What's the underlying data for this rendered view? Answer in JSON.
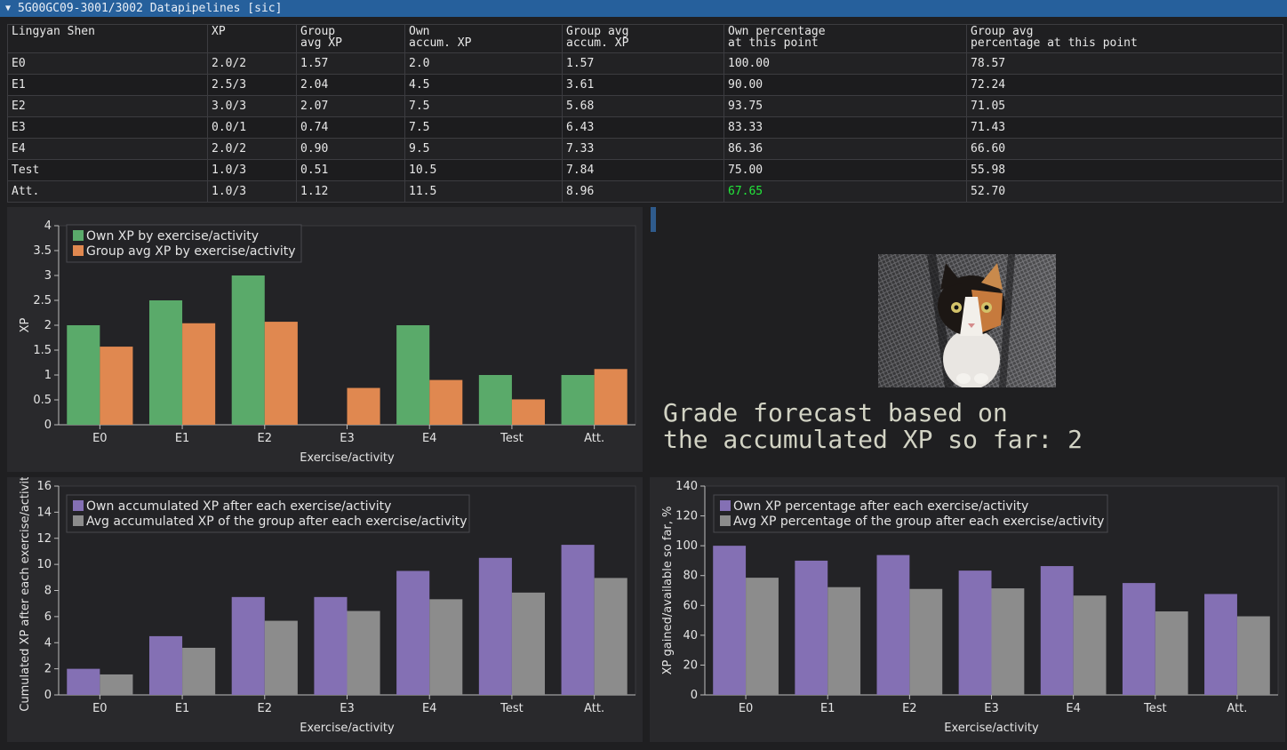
{
  "window": {
    "title": "5G00GC09-3001/3002 Datapipelines [sic]",
    "collapse_arrow": "▼"
  },
  "table": {
    "headers": [
      [
        "Lingyan Shen"
      ],
      [
        "XP"
      ],
      [
        "Group",
        "avg XP"
      ],
      [
        "Own",
        "accum. XP"
      ],
      [
        "Group avg",
        "accum. XP"
      ],
      [
        "Own percentage",
        "at this point"
      ],
      [
        "Group avg",
        "percentage at this point"
      ]
    ],
    "rows": [
      [
        "E0",
        "2.0/2",
        "1.57",
        "2.0",
        "1.57",
        "100.00",
        "78.57"
      ],
      [
        "E1",
        "2.5/3",
        "2.04",
        "4.5",
        "3.61",
        "90.00",
        "72.24"
      ],
      [
        "E2",
        "3.0/3",
        "2.07",
        "7.5",
        "5.68",
        "93.75",
        "71.05"
      ],
      [
        "E3",
        "0.0/1",
        "0.74",
        "7.5",
        "6.43",
        "83.33",
        "71.43"
      ],
      [
        "E4",
        "2.0/2",
        "0.90",
        "9.5",
        "7.33",
        "86.36",
        "66.60"
      ],
      [
        "Test",
        "1.0/3",
        "0.51",
        "10.5",
        "7.84",
        "75.00",
        "55.98"
      ],
      [
        "Att.",
        "1.0/3",
        "1.12",
        "11.5",
        "8.96",
        "67.65",
        "52.70"
      ]
    ],
    "highlight_cell": {
      "row": 6,
      "col": 5,
      "color": "#22e63a"
    }
  },
  "forecast": {
    "text": "Grade forecast based on\nthe accumulated XP so far: 2"
  },
  "image": {
    "subject": "calico-kitten-photo"
  },
  "colors": {
    "own_xp": "#5aaa6a",
    "group_xp": "#e08850",
    "own_accum": "#8470b4",
    "group_accum": "#8c8c8c",
    "background": "#1f1f21",
    "panel": "#29292c",
    "titlebar": "#26609c"
  },
  "chart_data": [
    {
      "type": "bar",
      "categories": [
        "E0",
        "E1",
        "E2",
        "E3",
        "E4",
        "Test",
        "Att."
      ],
      "series": [
        {
          "name": "Own XP by exercise/activity",
          "values": [
            2.0,
            2.5,
            3.0,
            0.0,
            2.0,
            1.0,
            1.0
          ]
        },
        {
          "name": "Group avg XP by exercise/activity",
          "values": [
            1.57,
            2.04,
            2.07,
            0.74,
            0.9,
            0.51,
            1.12
          ]
        }
      ],
      "xlabel": "Exercise/activity",
      "ylabel": "XP",
      "ylim": [
        0,
        4
      ],
      "yticks": [
        "0",
        "0.5",
        "1",
        "1.5",
        "2",
        "2.5",
        "3",
        "3.5",
        "4"
      ],
      "legend": "top-left",
      "grid": false
    },
    {
      "type": "bar",
      "categories": [
        "E0",
        "E1",
        "E2",
        "E3",
        "E4",
        "Test",
        "Att."
      ],
      "series": [
        {
          "name": "Own accumulated XP after each exercise/activity",
          "values": [
            2.0,
            4.5,
            7.5,
            7.5,
            9.5,
            10.5,
            11.5
          ]
        },
        {
          "name": "Avg accumulated XP of the group after each exercise/activity",
          "values": [
            1.57,
            3.61,
            5.68,
            6.43,
            7.33,
            7.84,
            8.96
          ]
        }
      ],
      "xlabel": "Exercise/activity",
      "ylabel": "Cumulated XP after each exercise/activity",
      "ylim": [
        0,
        16
      ],
      "yticks": [
        "0",
        "2",
        "4",
        "6",
        "8",
        "10",
        "12",
        "14",
        "16"
      ],
      "legend": "top-left",
      "grid": false
    },
    {
      "type": "bar",
      "categories": [
        "E0",
        "E1",
        "E2",
        "E3",
        "E4",
        "Test",
        "Att."
      ],
      "series": [
        {
          "name": "Own XP percentage after each exercise/activity",
          "values": [
            100.0,
            90.0,
            93.75,
            83.33,
            86.36,
            75.0,
            67.65
          ]
        },
        {
          "name": "Avg XP percentage of the group after each exercise/activity",
          "values": [
            78.57,
            72.24,
            71.05,
            71.43,
            66.6,
            55.98,
            52.7
          ]
        }
      ],
      "xlabel": "Exercise/activity",
      "ylabel": "XP gained/available so far, %",
      "ylim": [
        0,
        140
      ],
      "yticks": [
        "0",
        "20",
        "40",
        "60",
        "80",
        "100",
        "120",
        "140"
      ],
      "legend": "top-left",
      "grid": false
    }
  ]
}
